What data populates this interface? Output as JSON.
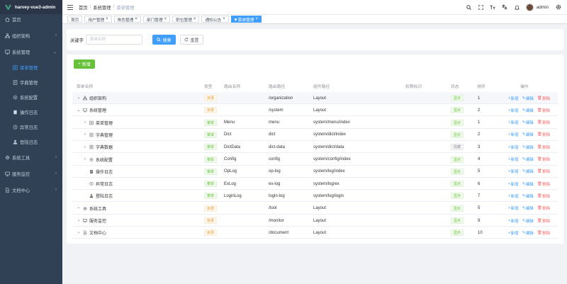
{
  "app": {
    "title": "harvey-vue3-admin"
  },
  "sidebar": {
    "items": [
      {
        "label": "首页",
        "icon": "home-icon",
        "level": 0
      },
      {
        "label": "组织架构",
        "icon": "org-icon",
        "level": 0,
        "arrow": "›"
      },
      {
        "label": "系统管理",
        "icon": "system-icon",
        "level": 0,
        "arrow": "⌄"
      },
      {
        "label": "菜单管理",
        "icon": "menu-icon",
        "level": 1,
        "active": true
      },
      {
        "label": "字典管理",
        "icon": "dict-icon",
        "level": 1
      },
      {
        "label": "系统配置",
        "icon": "config-icon",
        "level": 1
      },
      {
        "label": "操作日志",
        "icon": "oplog-icon",
        "level": 1
      },
      {
        "label": "异常日志",
        "icon": "exlog-icon",
        "level": 1
      },
      {
        "label": "登陆日志",
        "icon": "loginlog-icon",
        "level": 1
      },
      {
        "label": "系统工具",
        "icon": "tools-icon",
        "level": 0,
        "arrow": "›"
      },
      {
        "label": "服务监控",
        "icon": "monitor-icon",
        "level": 0,
        "arrow": "›"
      },
      {
        "label": "文档中心",
        "icon": "doc-icon",
        "level": 0,
        "arrow": "›"
      }
    ]
  },
  "breadcrumb": {
    "items": [
      "首页",
      "系统管理",
      "菜单管理"
    ],
    "sep": "/"
  },
  "header": {
    "username": "admin"
  },
  "tags": [
    {
      "label": "首页",
      "closable": false
    },
    {
      "label": "用户管理",
      "closable": true
    },
    {
      "label": "角色管理",
      "closable": true
    },
    {
      "label": "部门管理",
      "closable": true
    },
    {
      "label": "职位管理",
      "closable": true
    },
    {
      "label": "通知公告",
      "closable": true
    },
    {
      "label": "菜单管理",
      "closable": true,
      "active": true
    }
  ],
  "search": {
    "label": "关键字",
    "placeholder": "菜单名称",
    "search_button": "搜索",
    "reset_button": "重置"
  },
  "toolbar": {
    "add_button": "新增"
  },
  "table": {
    "columns": [
      "菜单名称",
      "类型",
      "路由名称",
      "路由路径",
      "组件路径",
      "权限标识",
      "状态",
      "排序",
      "操作"
    ],
    "actions": {
      "add": "新增",
      "edit": "编辑",
      "delete": "删除"
    },
    "rows": [
      {
        "name": "组织架构",
        "level": 0,
        "expand": "›",
        "icon": "org-icon",
        "type": "目录",
        "type_kind": "dir",
        "route_name": "",
        "route_path": "/organization",
        "component": "Layout",
        "perm": "",
        "status": "显示",
        "status_kind": "show",
        "sort": "1",
        "highlight": true
      },
      {
        "name": "系统管理",
        "level": 0,
        "expand": "⌄",
        "icon": "system-icon",
        "type": "目录",
        "type_kind": "dir",
        "route_name": "",
        "route_path": "/system",
        "component": "Layout",
        "perm": "",
        "status": "显示",
        "status_kind": "show",
        "sort": "2"
      },
      {
        "name": "菜单管理",
        "level": 1,
        "expand": "›",
        "icon": "menu-icon",
        "type": "菜单",
        "type_kind": "menu",
        "route_name": "Menu",
        "route_path": "menu",
        "component": "system/menu/index",
        "perm": "",
        "status": "显示",
        "status_kind": "show",
        "sort": "1"
      },
      {
        "name": "字典管理",
        "level": 1,
        "expand": "›",
        "icon": "dict-icon",
        "type": "菜单",
        "type_kind": "menu",
        "route_name": "Dict",
        "route_path": "dict",
        "component": "system/dict/index",
        "perm": "",
        "status": "显示",
        "status_kind": "show",
        "sort": "2"
      },
      {
        "name": "字典数据",
        "level": 1,
        "expand": "›",
        "icon": "dictdata-icon",
        "type": "菜单",
        "type_kind": "menu",
        "route_name": "DictData",
        "route_path": "dict-data",
        "component": "system/dict/data",
        "perm": "",
        "status": "隐藏",
        "status_kind": "hide",
        "sort": "3"
      },
      {
        "name": "系统配置",
        "level": 1,
        "expand": "›",
        "icon": "config-icon",
        "type": "菜单",
        "type_kind": "menu",
        "route_name": "Config",
        "route_path": "config",
        "component": "system/config/index",
        "perm": "",
        "status": "显示",
        "status_kind": "show",
        "sort": "4"
      },
      {
        "name": "操作日志",
        "level": 1,
        "expand": "",
        "icon": "oplog-icon",
        "type": "菜单",
        "type_kind": "menu",
        "route_name": "OpLog",
        "route_path": "op-log",
        "component": "system/log/index",
        "perm": "",
        "status": "显示",
        "status_kind": "show",
        "sort": "5"
      },
      {
        "name": "异常日志",
        "level": 1,
        "expand": "",
        "icon": "exlog-icon",
        "type": "菜单",
        "type_kind": "menu",
        "route_name": "ExLog",
        "route_path": "ex-log",
        "component": "system/log/ex",
        "perm": "",
        "status": "显示",
        "status_kind": "show",
        "sort": "6"
      },
      {
        "name": "登陆日志",
        "level": 1,
        "expand": "",
        "icon": "loginlog-icon",
        "type": "菜单",
        "type_kind": "menu",
        "route_name": "LoginLog",
        "route_path": "login-log",
        "component": "system/log/login",
        "perm": "",
        "status": "显示",
        "status_kind": "show",
        "sort": "7"
      },
      {
        "name": "系统工具",
        "level": 0,
        "expand": "›",
        "icon": "tools-icon",
        "type": "目录",
        "type_kind": "dir",
        "route_name": "",
        "route_path": "/tool",
        "component": "Layout",
        "perm": "",
        "status": "显示",
        "status_kind": "show",
        "sort": "5"
      },
      {
        "name": "服务监控",
        "level": 0,
        "expand": "›",
        "icon": "monitor-icon",
        "type": "目录",
        "type_kind": "dir",
        "route_name": "",
        "route_path": "/monitor",
        "component": "Layout",
        "perm": "",
        "status": "显示",
        "status_kind": "show",
        "sort": "9"
      },
      {
        "name": "文档中心",
        "level": 0,
        "expand": "›",
        "icon": "doc-icon",
        "type": "目录",
        "type_kind": "dir",
        "route_name": "",
        "route_path": "/document",
        "component": "Layout",
        "perm": "",
        "status": "显示",
        "status_kind": "show",
        "sort": "10"
      }
    ]
  },
  "colors": {
    "primary": "#409eff",
    "success": "#67c23a",
    "warning": "#e6a23c",
    "danger": "#f56c6c",
    "sidebar_bg": "#304156"
  }
}
